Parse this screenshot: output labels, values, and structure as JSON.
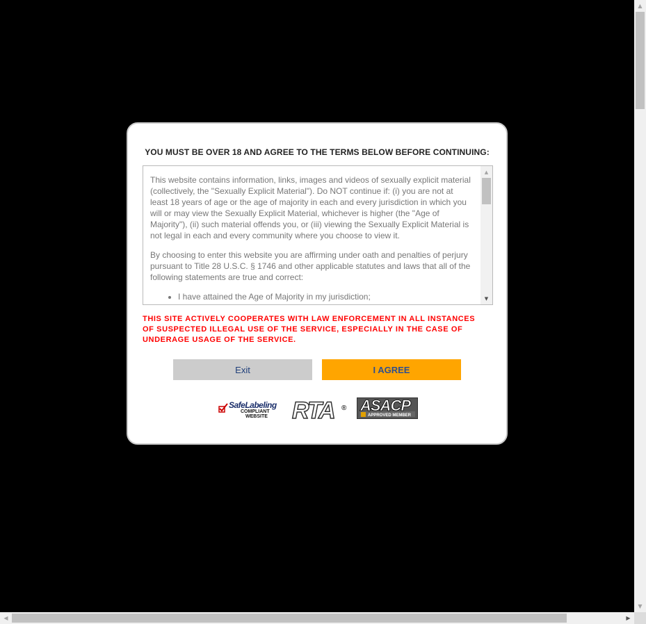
{
  "modal": {
    "title": "YOU MUST BE OVER 18 AND AGREE TO THE TERMS BELOW BEFORE CONTINUING:",
    "terms": {
      "paragraph1": "This website contains information, links, images and videos of sexually explicit material (collectively, the \"Sexually Explicit Material\"). Do NOT continue if: (i) you are not at least 18 years of age or the age of majority in each and every jurisdiction in which you will or may view the Sexually Explicit Material, whichever is higher (the \"Age of Majority\"), (ii) such material offends you, or (iii) viewing the Sexually Explicit Material is not legal in each and every community where you choose to view it.",
      "paragraph2": "By choosing to enter this website you are affirming under oath and penalties of perjury pursuant to Title 28 U.S.C. § 1746 and other applicable statutes and laws that all of the following statements are true and correct:",
      "list_items": [
        "I have attained the Age of Majority in my jurisdiction;"
      ]
    },
    "warning": "THIS SITE ACTIVELY COOPERATES WITH LAW ENFORCEMENT IN ALL INSTANCES OF SUSPECTED ILLEGAL USE OF THE SERVICE, ESPECIALLY IN THE CASE OF UNDERAGE USAGE OF THE SERVICE.",
    "buttons": {
      "exit_label": "Exit",
      "agree_label": "I AGREE"
    },
    "logos": {
      "safelabeling_title": "SafeLabeling",
      "safelabeling_sub1": "COMPLIANT",
      "safelabeling_sub2": "WEBSITE",
      "rta_text": "RTA",
      "rta_reg": "®",
      "asacp_text": "ASACP",
      "asacp_sub": "APPROVED MEMBER"
    }
  },
  "colors": {
    "background": "#000000",
    "agree_button": "#ffa500",
    "exit_button": "#cccccc",
    "warning": "#ff0000"
  }
}
